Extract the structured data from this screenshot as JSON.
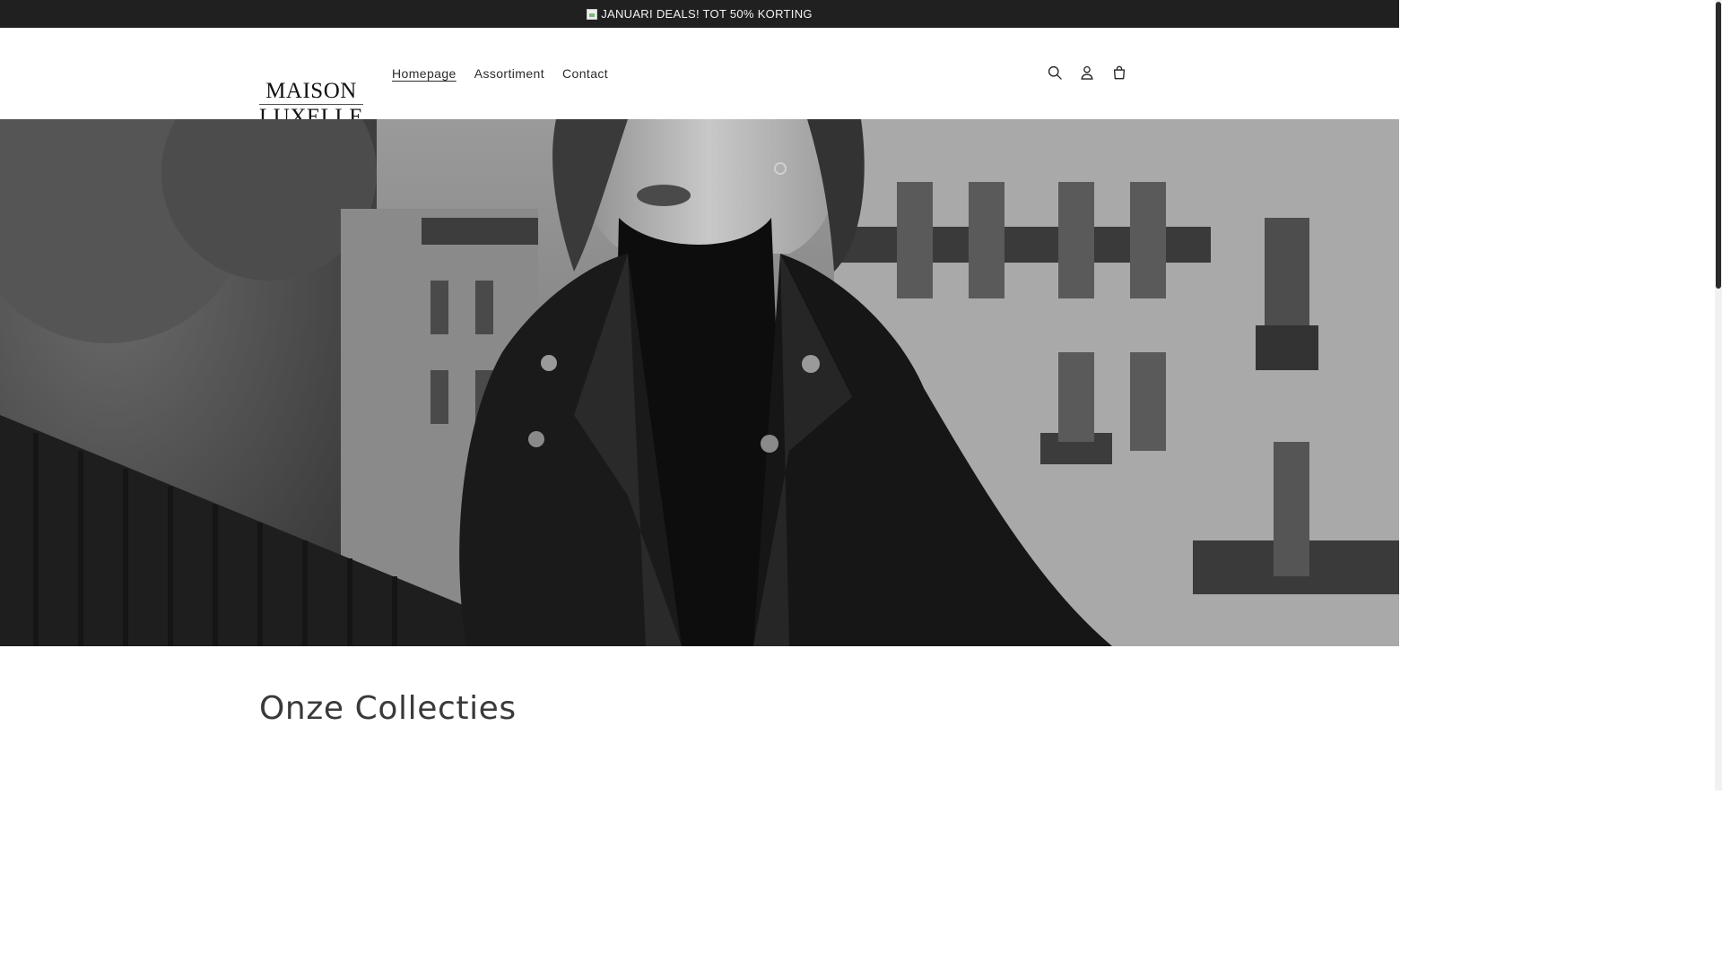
{
  "announcement": {
    "text": "JANUARI DEALS! TOT 50% KORTING",
    "icon": "broken-image-icon"
  },
  "header": {
    "logo": {
      "line1": "MAISON",
      "line2": "LUXELLE"
    },
    "nav": [
      {
        "label": "Homepage",
        "active": true
      },
      {
        "label": "Assortiment",
        "active": false
      },
      {
        "label": "Contact",
        "active": false
      }
    ],
    "icons": [
      "search-icon",
      "account-icon",
      "cart-icon"
    ]
  },
  "hero": {
    "image": "hero-image-woman-leather-jacket-paris-street"
  },
  "collections": {
    "title": "Onze Collecties"
  },
  "colors": {
    "announcement_bg": "#202020",
    "announcement_text": "#f3f3f3",
    "header_bg": "#ffffff",
    "nav_text": "#2b2b2b",
    "title_text": "#3a3a3a"
  }
}
